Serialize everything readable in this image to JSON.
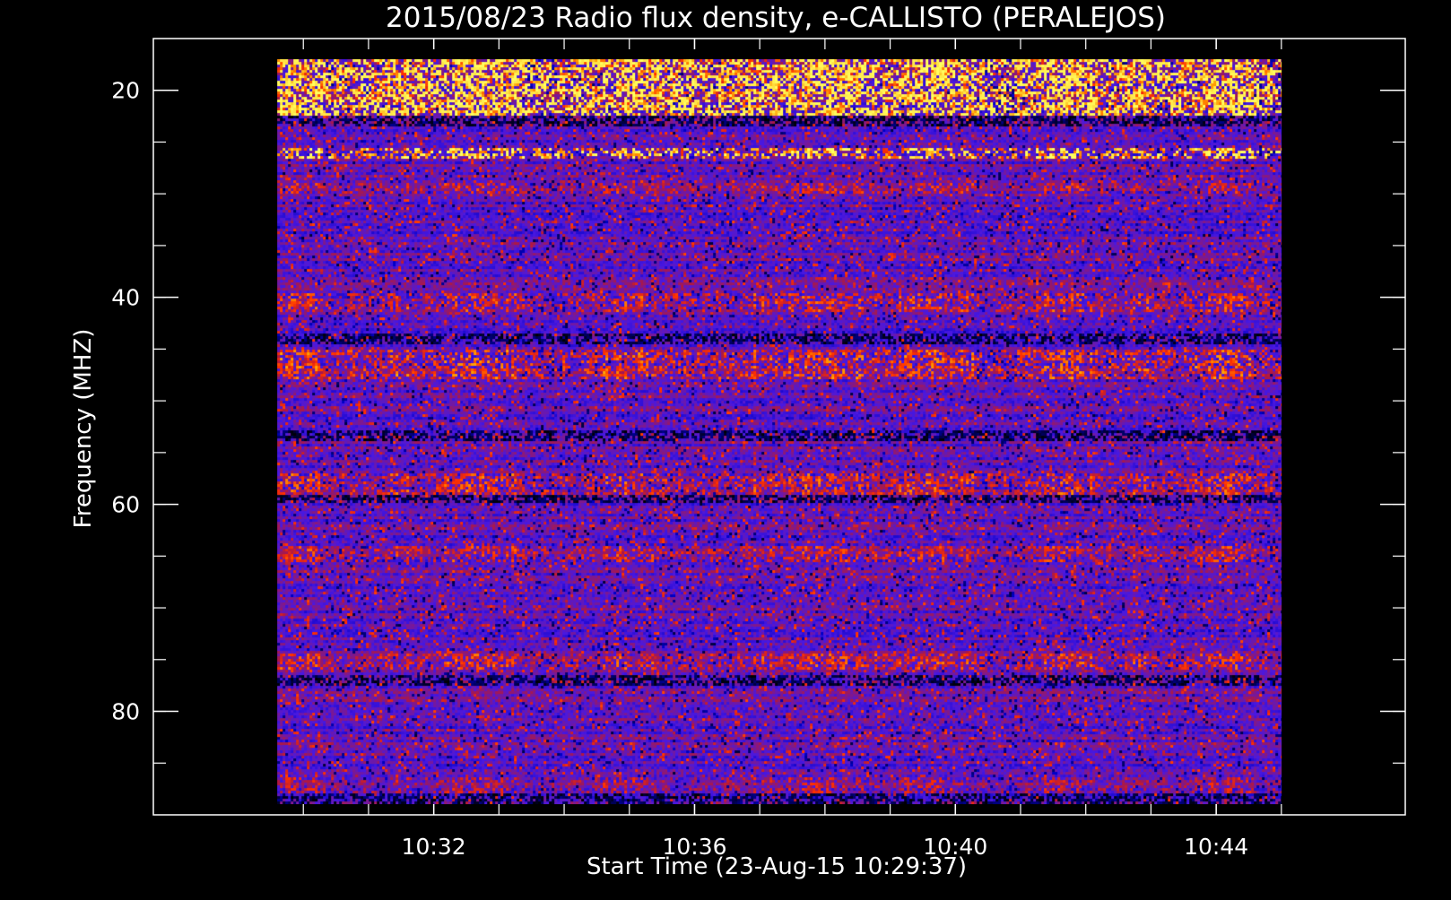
{
  "chart_data": {
    "type": "heatmap",
    "title": "2015/08/23  Radio flux density, e-CALLISTO (PERALEJOS)",
    "xlabel": "Start Time (23-Aug-15 10:29:37)",
    "ylabel": "Frequency (MHZ)",
    "x_axis": {
      "unit": "time",
      "start": "10:29:37",
      "end": "10:44:59",
      "range_minutes": [
        29.6,
        45.0
      ],
      "major_ticks": [
        {
          "value": 32,
          "label": "10:32"
        },
        {
          "value": 36,
          "label": "10:36"
        },
        {
          "value": 40,
          "label": "10:40"
        },
        {
          "value": 44,
          "label": "10:44"
        }
      ],
      "minor_tick_step": 1
    },
    "y_axis": {
      "unit": "MHz",
      "inverted": true,
      "range": [
        15,
        90
      ],
      "data_range": [
        17,
        89
      ],
      "major_ticks": [
        {
          "value": 20,
          "label": "20"
        },
        {
          "value": 40,
          "label": "40"
        },
        {
          "value": 60,
          "label": "60"
        },
        {
          "value": 80,
          "label": "80"
        }
      ],
      "minor_tick_step": 5
    },
    "colormap": [
      "#000000",
      "#0000c8",
      "#4a18e0",
      "#b01840",
      "#ff3000",
      "#ff9a00",
      "#ffff60"
    ],
    "intensity_scale": "relative 0-1",
    "bright_bands_mhz": [
      {
        "from": 17,
        "to": 22.5,
        "level": 0.85
      },
      {
        "from": 25.5,
        "to": 26.5,
        "level": 0.9
      },
      {
        "from": 29,
        "to": 30,
        "level": 0.55
      },
      {
        "from": 39.5,
        "to": 41.5,
        "level": 0.6
      },
      {
        "from": 45,
        "to": 48,
        "level": 0.65
      },
      {
        "from": 57,
        "to": 59,
        "level": 0.62
      },
      {
        "from": 64,
        "to": 65.5,
        "level": 0.58
      },
      {
        "from": 74.5,
        "to": 76,
        "level": 0.6
      },
      {
        "from": 86.5,
        "to": 88,
        "level": 0.5
      }
    ],
    "dark_bands_mhz": [
      {
        "from": 22.5,
        "to": 23.5
      },
      {
        "from": 43.5,
        "to": 44.5
      },
      {
        "from": 53,
        "to": 54
      },
      {
        "from": 59,
        "to": 60
      },
      {
        "from": 76.5,
        "to": 77.5
      },
      {
        "from": 88,
        "to": 89
      }
    ],
    "grid": false,
    "legend": "none"
  }
}
